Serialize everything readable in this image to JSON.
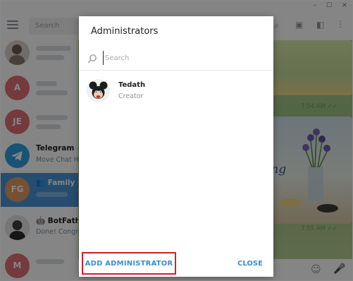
{
  "window": {
    "controls": [
      "–",
      "☐",
      "✕"
    ]
  },
  "sidebar": {
    "search_placeholder": "Search",
    "chats": [
      {
        "initials": "",
        "color": "#c9c9c9",
        "name": "",
        "preview": ""
      },
      {
        "initials": "A",
        "color": "#e17076",
        "name": "",
        "preview": ""
      },
      {
        "initials": "JE",
        "color": "#e17076",
        "name": "",
        "preview": ""
      },
      {
        "initials": "",
        "color": "#2f9ee0",
        "name": "Telegram",
        "preview": "Move Chat Hi"
      },
      {
        "initials": "FG",
        "color": "#e39a62",
        "name": "Family Gr",
        "preview": ""
      },
      {
        "initials": "",
        "color": "#bfbfbf",
        "name": "BotFathe",
        "preview": "Done! Congra"
      },
      {
        "initials": "M",
        "color": "#e17076",
        "name": "",
        "preview": ""
      }
    ]
  },
  "conversation": {
    "times": [
      "7:54 AM",
      "7:55 AM"
    ],
    "photo_caption": "ing"
  },
  "dialog": {
    "title": "Administrators",
    "search_placeholder": "Search",
    "members": [
      {
        "name": "Tedath",
        "role": "Creator"
      }
    ],
    "add_button": "ADD ADMINISTRATOR",
    "close_button": "CLOSE"
  },
  "colors": {
    "accent": "#3a8fd1",
    "highlight_border": "#d32027",
    "active_chat": "#4a95d5"
  }
}
